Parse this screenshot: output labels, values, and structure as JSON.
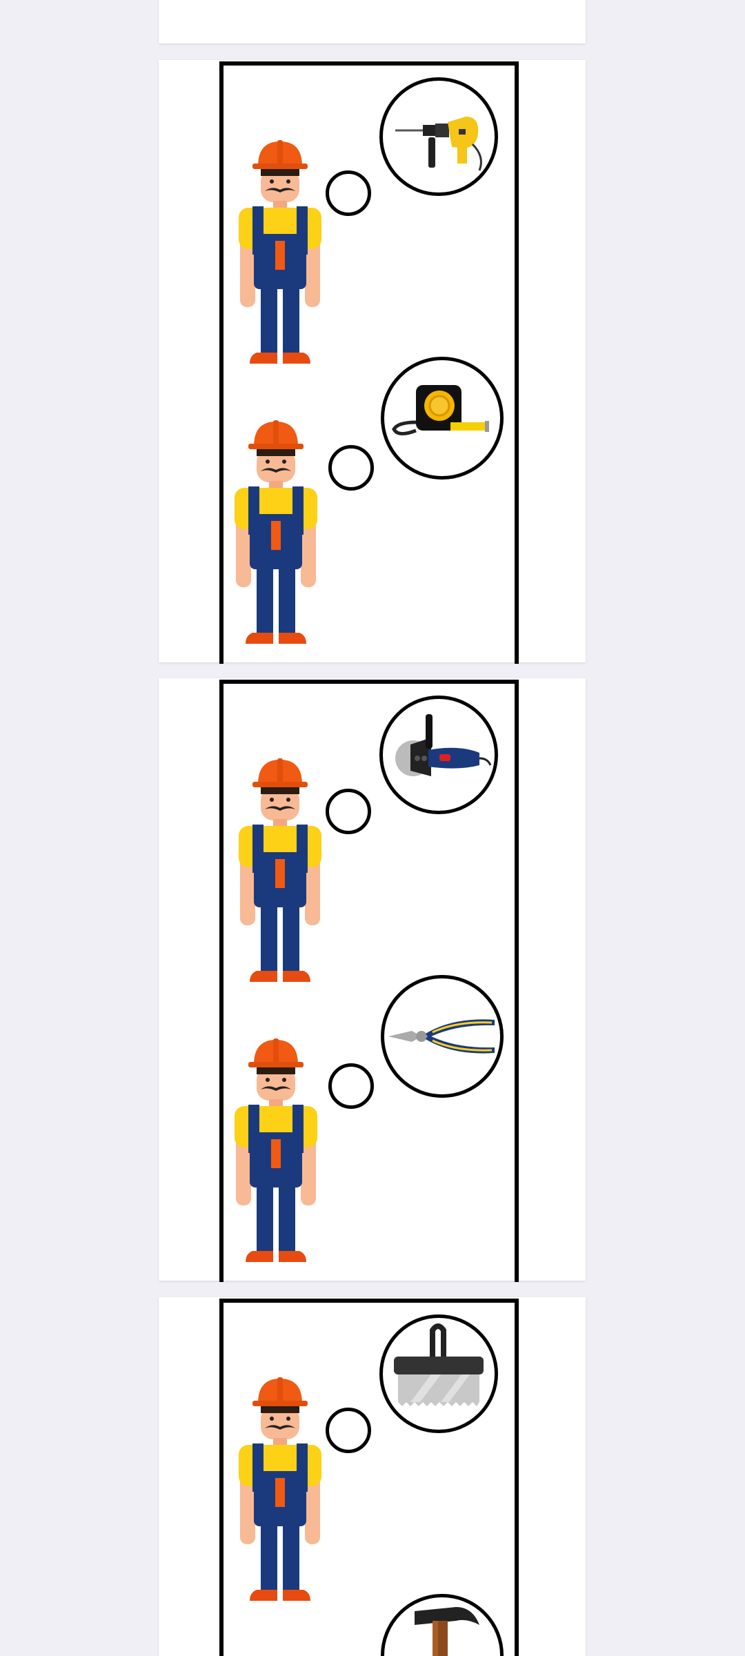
{
  "viewer": {
    "pages": [
      {
        "page": "top-partial",
        "items": []
      },
      {
        "page": "1",
        "items": [
          {
            "worker": "worker",
            "thought_icon": "hammer-drill-icon"
          },
          {
            "worker": "worker",
            "thought_icon": "tape-measure-icon"
          }
        ]
      },
      {
        "page": "2",
        "items": [
          {
            "worker": "worker",
            "thought_icon": "angle-grinder-icon"
          },
          {
            "worker": "worker",
            "thought_icon": "pliers-icon"
          }
        ]
      },
      {
        "page": "3",
        "items": [
          {
            "worker": "worker",
            "thought_icon": "notched-trowel-icon"
          },
          {
            "worker": "worker",
            "thought_icon": "hammer-icon"
          }
        ]
      }
    ]
  },
  "colors": {
    "background": "#efeff5",
    "helmet": "#f05a12",
    "shirt": "#fcd116",
    "overalls": "#1b3a7d",
    "skin": "#f8b995",
    "boots": "#e84b10",
    "outline": "#000000"
  }
}
